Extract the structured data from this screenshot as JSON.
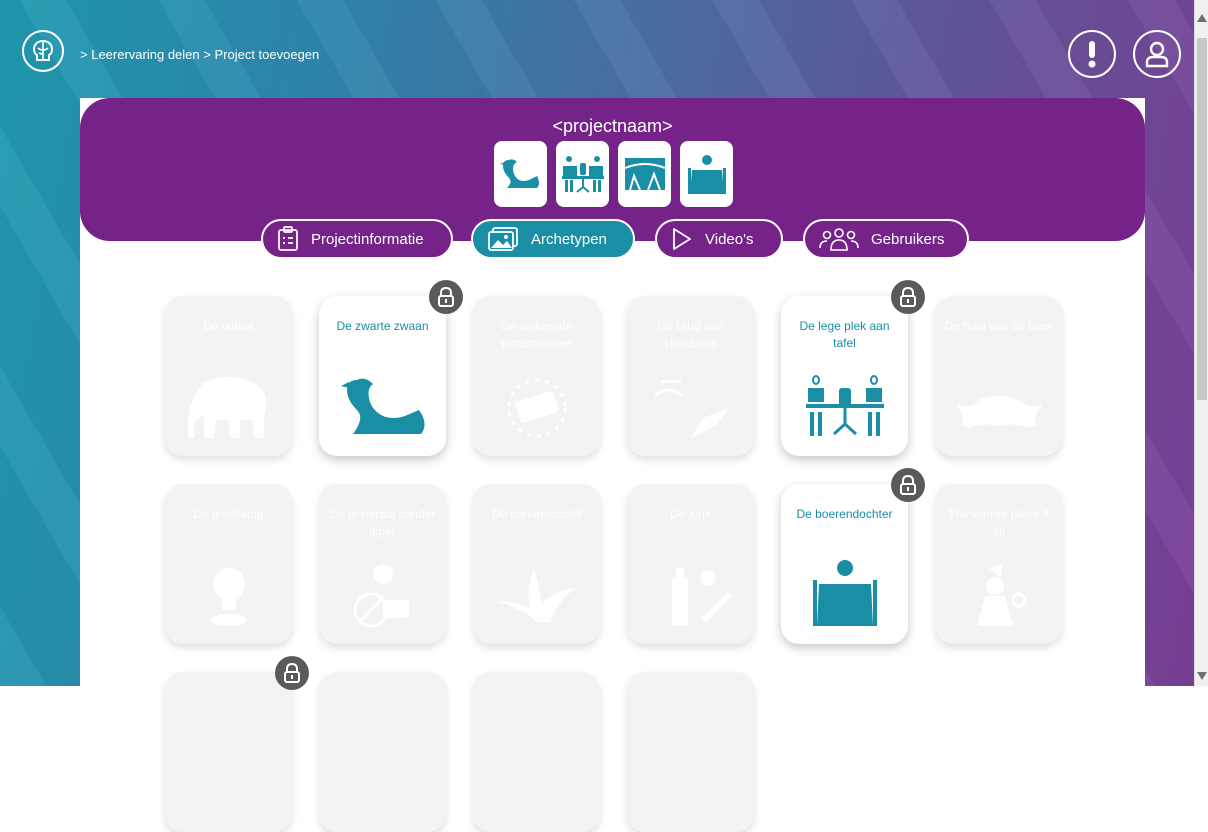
{
  "breadcrumb": {
    "sep1": ">",
    "item1": "Leerervaring delen",
    "sep2": ">",
    "item2": "Project toevoegen"
  },
  "header": {
    "project_name": "<projectnaam>"
  },
  "thumbnails": [
    "swan-icon",
    "meeting-icon",
    "bridge-icon",
    "farmer-icon"
  ],
  "tabs": {
    "info": "Projectinformatie",
    "archetypes": "Archetypen",
    "videos": "Video's",
    "users": "Gebruikers"
  },
  "cards": [
    {
      "title": "De olifant",
      "icon": "elephant-icon",
      "active": false
    },
    {
      "title": "De zwarte zwaan",
      "icon": "swan-icon",
      "active": true,
      "locked": true
    },
    {
      "title": "De verkeerde portemonnee",
      "icon": "wallet-icon",
      "active": false
    },
    {
      "title": "De brug van Honduras",
      "icon": "bridge-icon",
      "active": false
    },
    {
      "title": "De lege plek aan tafel",
      "icon": "meeting-icon",
      "active": true,
      "locked": true
    },
    {
      "title": "De huid van de beer",
      "icon": "bearskin-icon",
      "active": false
    },
    {
      "title": "De gloeilamp",
      "icon": "lightbulb-icon",
      "active": false
    },
    {
      "title": "De generaal zonder leger",
      "icon": "general-icon",
      "active": false
    },
    {
      "title": "De bananenschil",
      "icon": "banana-peel-icon",
      "active": false
    },
    {
      "title": "De junk",
      "icon": "junk-icon",
      "active": false
    },
    {
      "title": "De boerendochter",
      "icon": "farmer-icon",
      "active": true,
      "locked": true
    },
    {
      "title": "The winner takes it all",
      "icon": "trophy-icon",
      "active": false
    }
  ],
  "colors": {
    "purple": "#752389",
    "teal": "#1a8ea5",
    "lock": "#5a5a5a"
  }
}
